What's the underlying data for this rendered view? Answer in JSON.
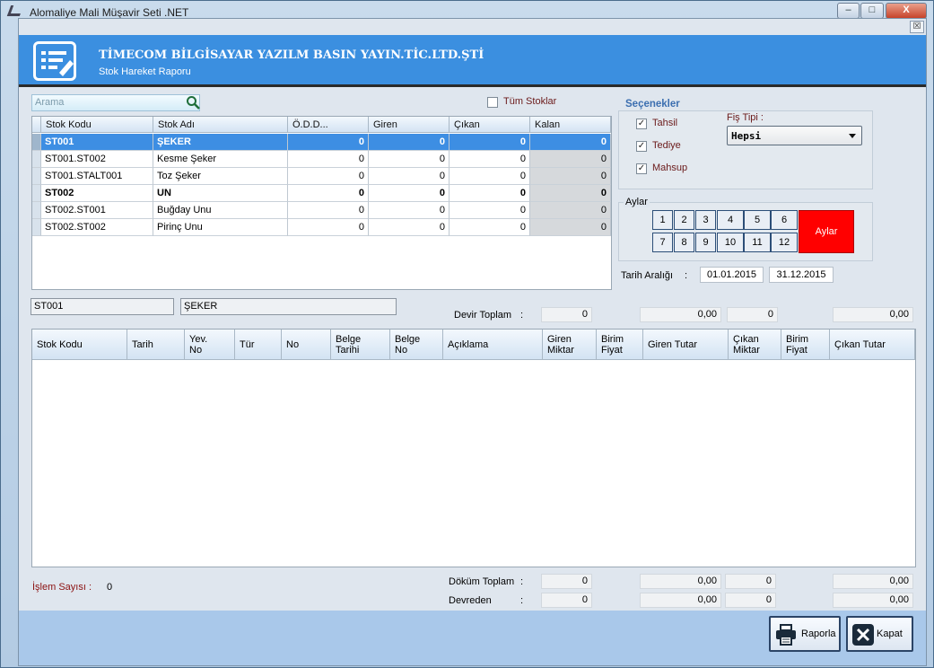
{
  "window": {
    "title": "Alomaliye Mali Müşavir Seti .NET",
    "minimize": "–",
    "maximize": "□",
    "close": "X"
  },
  "dialog": {
    "close": "☒"
  },
  "header": {
    "company": "TİMECOM BİLGİSAYAR YAZILM BASIN YAYIN.TİC.LTD.ŞTİ",
    "subtitle": "Stok Hareket Raporu"
  },
  "search": {
    "placeholder": "Arama"
  },
  "all_stocks": {
    "label": "Tüm Stoklar",
    "checked": false
  },
  "stock_grid": {
    "columns": [
      "Stok Kodu",
      "Stok Adı",
      "Ö.D.D...",
      "Giren",
      "Çıkan",
      "Kalan"
    ],
    "rows": [
      {
        "code": "ST001",
        "name": "ŞEKER",
        "odd": "0",
        "giren": "0",
        "cikan": "0",
        "kalan": "0"
      },
      {
        "code": "ST001.ST002",
        "name": "Kesme Şeker",
        "odd": "0",
        "giren": "0",
        "cikan": "0",
        "kalan": "0"
      },
      {
        "code": "ST001.STALT001",
        "name": "Toz Şeker",
        "odd": "0",
        "giren": "0",
        "cikan": "0",
        "kalan": "0"
      },
      {
        "code": "ST002",
        "name": "UN",
        "odd": "0",
        "giren": "0",
        "cikan": "0",
        "kalan": "0"
      },
      {
        "code": "ST002.ST001",
        "name": "Buğday Unu",
        "odd": "0",
        "giren": "0",
        "cikan": "0",
        "kalan": "0"
      },
      {
        "code": "ST002.ST002",
        "name": "Pirinç Unu",
        "odd": "0",
        "giren": "0",
        "cikan": "0",
        "kalan": "0"
      }
    ]
  },
  "options": {
    "title": "Seçenekler",
    "tahsil": "Tahsil",
    "tediye": "Tediye",
    "mahsup": "Mahsup",
    "check": "✓",
    "fis_tipi_label": "Fiş Tipi  :",
    "fis_tipi_value": "Hepsi"
  },
  "months": {
    "title": "Aylar",
    "buttons": [
      "1",
      "2",
      "3",
      "4",
      "5",
      "6",
      "7",
      "8",
      "9",
      "10",
      "11",
      "12"
    ],
    "all_label": "Aylar",
    "all_color": "#ff0000"
  },
  "date_range": {
    "label": "Tarih Aralığı",
    "colon": ":",
    "start": "01.01.2015",
    "end": "31.12.2015"
  },
  "selected": {
    "code": "ST001",
    "name": "ŞEKER"
  },
  "devir_toplam": {
    "label": "Devir Toplam",
    "colon": ":",
    "values": [
      "0",
      "0,00",
      "0",
      "0,00"
    ]
  },
  "movement_grid": {
    "columns": [
      "Stok Kodu",
      "Tarih",
      "Yev.\nNo",
      "Tür",
      "No",
      "Belge\nTarihi",
      "Belge\nNo",
      "Açıklama",
      "Giren\nMiktar",
      "Birim\nFiyat",
      "Giren Tutar",
      "Çıkan\nMiktar",
      "Birim\nFiyat",
      "Çıkan Tutar"
    ]
  },
  "islem": {
    "label": "İşlem Sayısı :",
    "value": "0"
  },
  "dokum_toplam": {
    "label": "Döküm Toplam",
    "colon": ":",
    "values": [
      "0",
      "0,00",
      "0",
      "0,00"
    ]
  },
  "devreden": {
    "label": "Devreden",
    "colon": ":",
    "values": [
      "0",
      "0,00",
      "0",
      "0,00"
    ]
  },
  "footer": {
    "report": "Raporla",
    "close": "Kapat"
  }
}
